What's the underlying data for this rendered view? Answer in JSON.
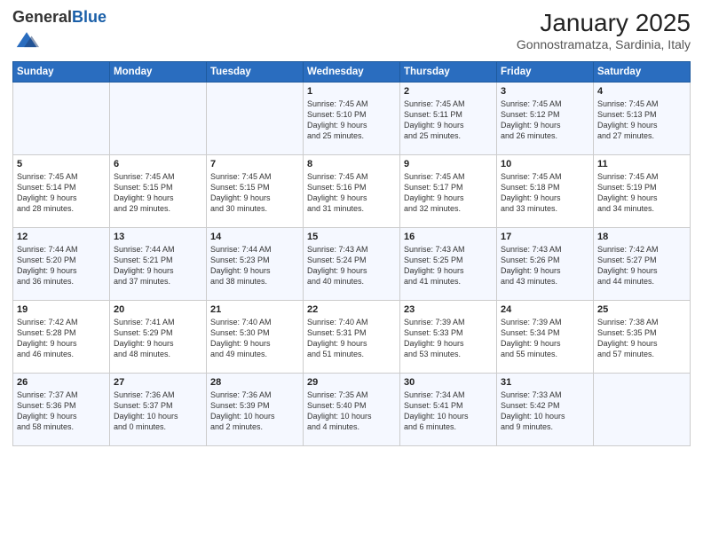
{
  "header": {
    "logo_general": "General",
    "logo_blue": "Blue",
    "title": "January 2025",
    "subtitle": "Gonnostramatza, Sardinia, Italy"
  },
  "columns": [
    "Sunday",
    "Monday",
    "Tuesday",
    "Wednesday",
    "Thursday",
    "Friday",
    "Saturday"
  ],
  "weeks": [
    [
      {
        "day": "",
        "info": ""
      },
      {
        "day": "",
        "info": ""
      },
      {
        "day": "",
        "info": ""
      },
      {
        "day": "1",
        "info": "Sunrise: 7:45 AM\nSunset: 5:10 PM\nDaylight: 9 hours\nand 25 minutes."
      },
      {
        "day": "2",
        "info": "Sunrise: 7:45 AM\nSunset: 5:11 PM\nDaylight: 9 hours\nand 25 minutes."
      },
      {
        "day": "3",
        "info": "Sunrise: 7:45 AM\nSunset: 5:12 PM\nDaylight: 9 hours\nand 26 minutes."
      },
      {
        "day": "4",
        "info": "Sunrise: 7:45 AM\nSunset: 5:13 PM\nDaylight: 9 hours\nand 27 minutes."
      }
    ],
    [
      {
        "day": "5",
        "info": "Sunrise: 7:45 AM\nSunset: 5:14 PM\nDaylight: 9 hours\nand 28 minutes."
      },
      {
        "day": "6",
        "info": "Sunrise: 7:45 AM\nSunset: 5:15 PM\nDaylight: 9 hours\nand 29 minutes."
      },
      {
        "day": "7",
        "info": "Sunrise: 7:45 AM\nSunset: 5:15 PM\nDaylight: 9 hours\nand 30 minutes."
      },
      {
        "day": "8",
        "info": "Sunrise: 7:45 AM\nSunset: 5:16 PM\nDaylight: 9 hours\nand 31 minutes."
      },
      {
        "day": "9",
        "info": "Sunrise: 7:45 AM\nSunset: 5:17 PM\nDaylight: 9 hours\nand 32 minutes."
      },
      {
        "day": "10",
        "info": "Sunrise: 7:45 AM\nSunset: 5:18 PM\nDaylight: 9 hours\nand 33 minutes."
      },
      {
        "day": "11",
        "info": "Sunrise: 7:45 AM\nSunset: 5:19 PM\nDaylight: 9 hours\nand 34 minutes."
      }
    ],
    [
      {
        "day": "12",
        "info": "Sunrise: 7:44 AM\nSunset: 5:20 PM\nDaylight: 9 hours\nand 36 minutes."
      },
      {
        "day": "13",
        "info": "Sunrise: 7:44 AM\nSunset: 5:21 PM\nDaylight: 9 hours\nand 37 minutes."
      },
      {
        "day": "14",
        "info": "Sunrise: 7:44 AM\nSunset: 5:23 PM\nDaylight: 9 hours\nand 38 minutes."
      },
      {
        "day": "15",
        "info": "Sunrise: 7:43 AM\nSunset: 5:24 PM\nDaylight: 9 hours\nand 40 minutes."
      },
      {
        "day": "16",
        "info": "Sunrise: 7:43 AM\nSunset: 5:25 PM\nDaylight: 9 hours\nand 41 minutes."
      },
      {
        "day": "17",
        "info": "Sunrise: 7:43 AM\nSunset: 5:26 PM\nDaylight: 9 hours\nand 43 minutes."
      },
      {
        "day": "18",
        "info": "Sunrise: 7:42 AM\nSunset: 5:27 PM\nDaylight: 9 hours\nand 44 minutes."
      }
    ],
    [
      {
        "day": "19",
        "info": "Sunrise: 7:42 AM\nSunset: 5:28 PM\nDaylight: 9 hours\nand 46 minutes."
      },
      {
        "day": "20",
        "info": "Sunrise: 7:41 AM\nSunset: 5:29 PM\nDaylight: 9 hours\nand 48 minutes."
      },
      {
        "day": "21",
        "info": "Sunrise: 7:40 AM\nSunset: 5:30 PM\nDaylight: 9 hours\nand 49 minutes."
      },
      {
        "day": "22",
        "info": "Sunrise: 7:40 AM\nSunset: 5:31 PM\nDaylight: 9 hours\nand 51 minutes."
      },
      {
        "day": "23",
        "info": "Sunrise: 7:39 AM\nSunset: 5:33 PM\nDaylight: 9 hours\nand 53 minutes."
      },
      {
        "day": "24",
        "info": "Sunrise: 7:39 AM\nSunset: 5:34 PM\nDaylight: 9 hours\nand 55 minutes."
      },
      {
        "day": "25",
        "info": "Sunrise: 7:38 AM\nSunset: 5:35 PM\nDaylight: 9 hours\nand 57 minutes."
      }
    ],
    [
      {
        "day": "26",
        "info": "Sunrise: 7:37 AM\nSunset: 5:36 PM\nDaylight: 9 hours\nand 58 minutes."
      },
      {
        "day": "27",
        "info": "Sunrise: 7:36 AM\nSunset: 5:37 PM\nDaylight: 10 hours\nand 0 minutes."
      },
      {
        "day": "28",
        "info": "Sunrise: 7:36 AM\nSunset: 5:39 PM\nDaylight: 10 hours\nand 2 minutes."
      },
      {
        "day": "29",
        "info": "Sunrise: 7:35 AM\nSunset: 5:40 PM\nDaylight: 10 hours\nand 4 minutes."
      },
      {
        "day": "30",
        "info": "Sunrise: 7:34 AM\nSunset: 5:41 PM\nDaylight: 10 hours\nand 6 minutes."
      },
      {
        "day": "31",
        "info": "Sunrise: 7:33 AM\nSunset: 5:42 PM\nDaylight: 10 hours\nand 9 minutes."
      },
      {
        "day": "",
        "info": ""
      }
    ]
  ]
}
